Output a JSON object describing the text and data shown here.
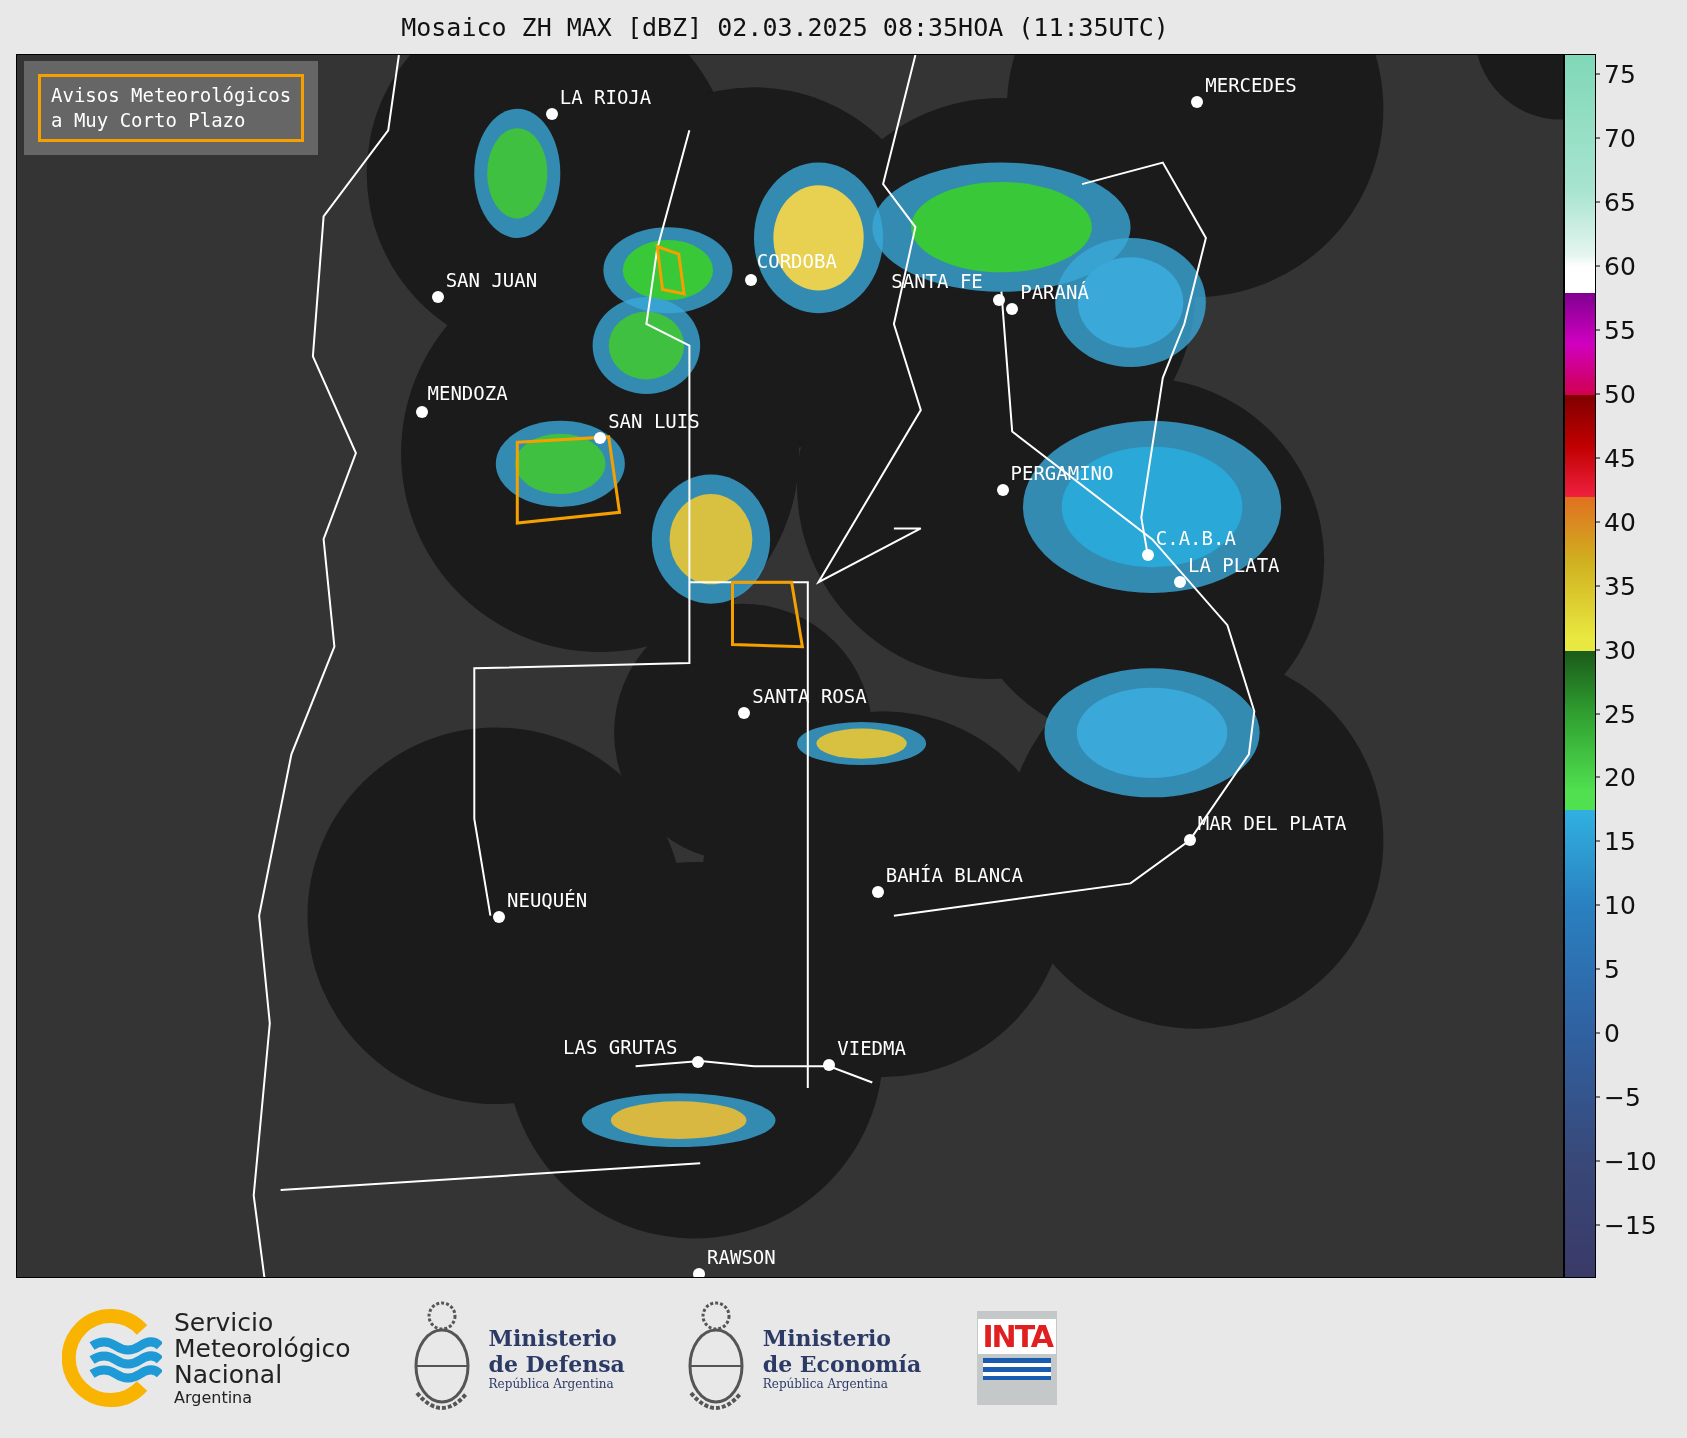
{
  "title": "Mosaico ZH MAX [dBZ] 02.03.2025 08:35HOA (11:35UTC)",
  "warning_box": {
    "lines": [
      "Avisos Meteorológicos",
      "a Muy Corto Plazo"
    ]
  },
  "cities": [
    {
      "name": "LA RIOJA"
    },
    {
      "name": "MERCEDES"
    },
    {
      "name": "SAN JUAN"
    },
    {
      "name": "CORDOBA"
    },
    {
      "name": "SANTA FE"
    },
    {
      "name": "PARANÁ"
    },
    {
      "name": "MENDOZA"
    },
    {
      "name": "SAN LUIS"
    },
    {
      "name": "PERGAMINO"
    },
    {
      "name": "C.A.B.A"
    },
    {
      "name": "LA PLATA"
    },
    {
      "name": "SANTA ROSA"
    },
    {
      "name": "MAR DEL PLATA"
    },
    {
      "name": "BAHÍA BLANCA"
    },
    {
      "name": "NEUQUÉN"
    },
    {
      "name": "LAS GRUTAS"
    },
    {
      "name": "VIEDMA"
    },
    {
      "name": "RAWSON"
    }
  ],
  "colorbar": {
    "ticks": [
      "75",
      "70",
      "65",
      "60",
      "55",
      "50",
      "45",
      "40",
      "35",
      "30",
      "25",
      "20",
      "15",
      "10",
      "5",
      "0",
      "−5",
      "−10",
      "−15"
    ]
  },
  "logos": [
    {
      "kind": "smn",
      "lines": [
        "Servicio",
        "Meteorológico",
        "Nacional"
      ],
      "subtitle": "Argentina"
    },
    {
      "kind": "ministry",
      "lines": [
        "Ministerio",
        "de Defensa"
      ],
      "subtitle": "República Argentina"
    },
    {
      "kind": "ministry",
      "lines": [
        "Ministerio",
        "de Economía"
      ],
      "subtitle": "República Argentina"
    },
    {
      "kind": "inta",
      "lines": [
        "INTA"
      ]
    }
  ]
}
